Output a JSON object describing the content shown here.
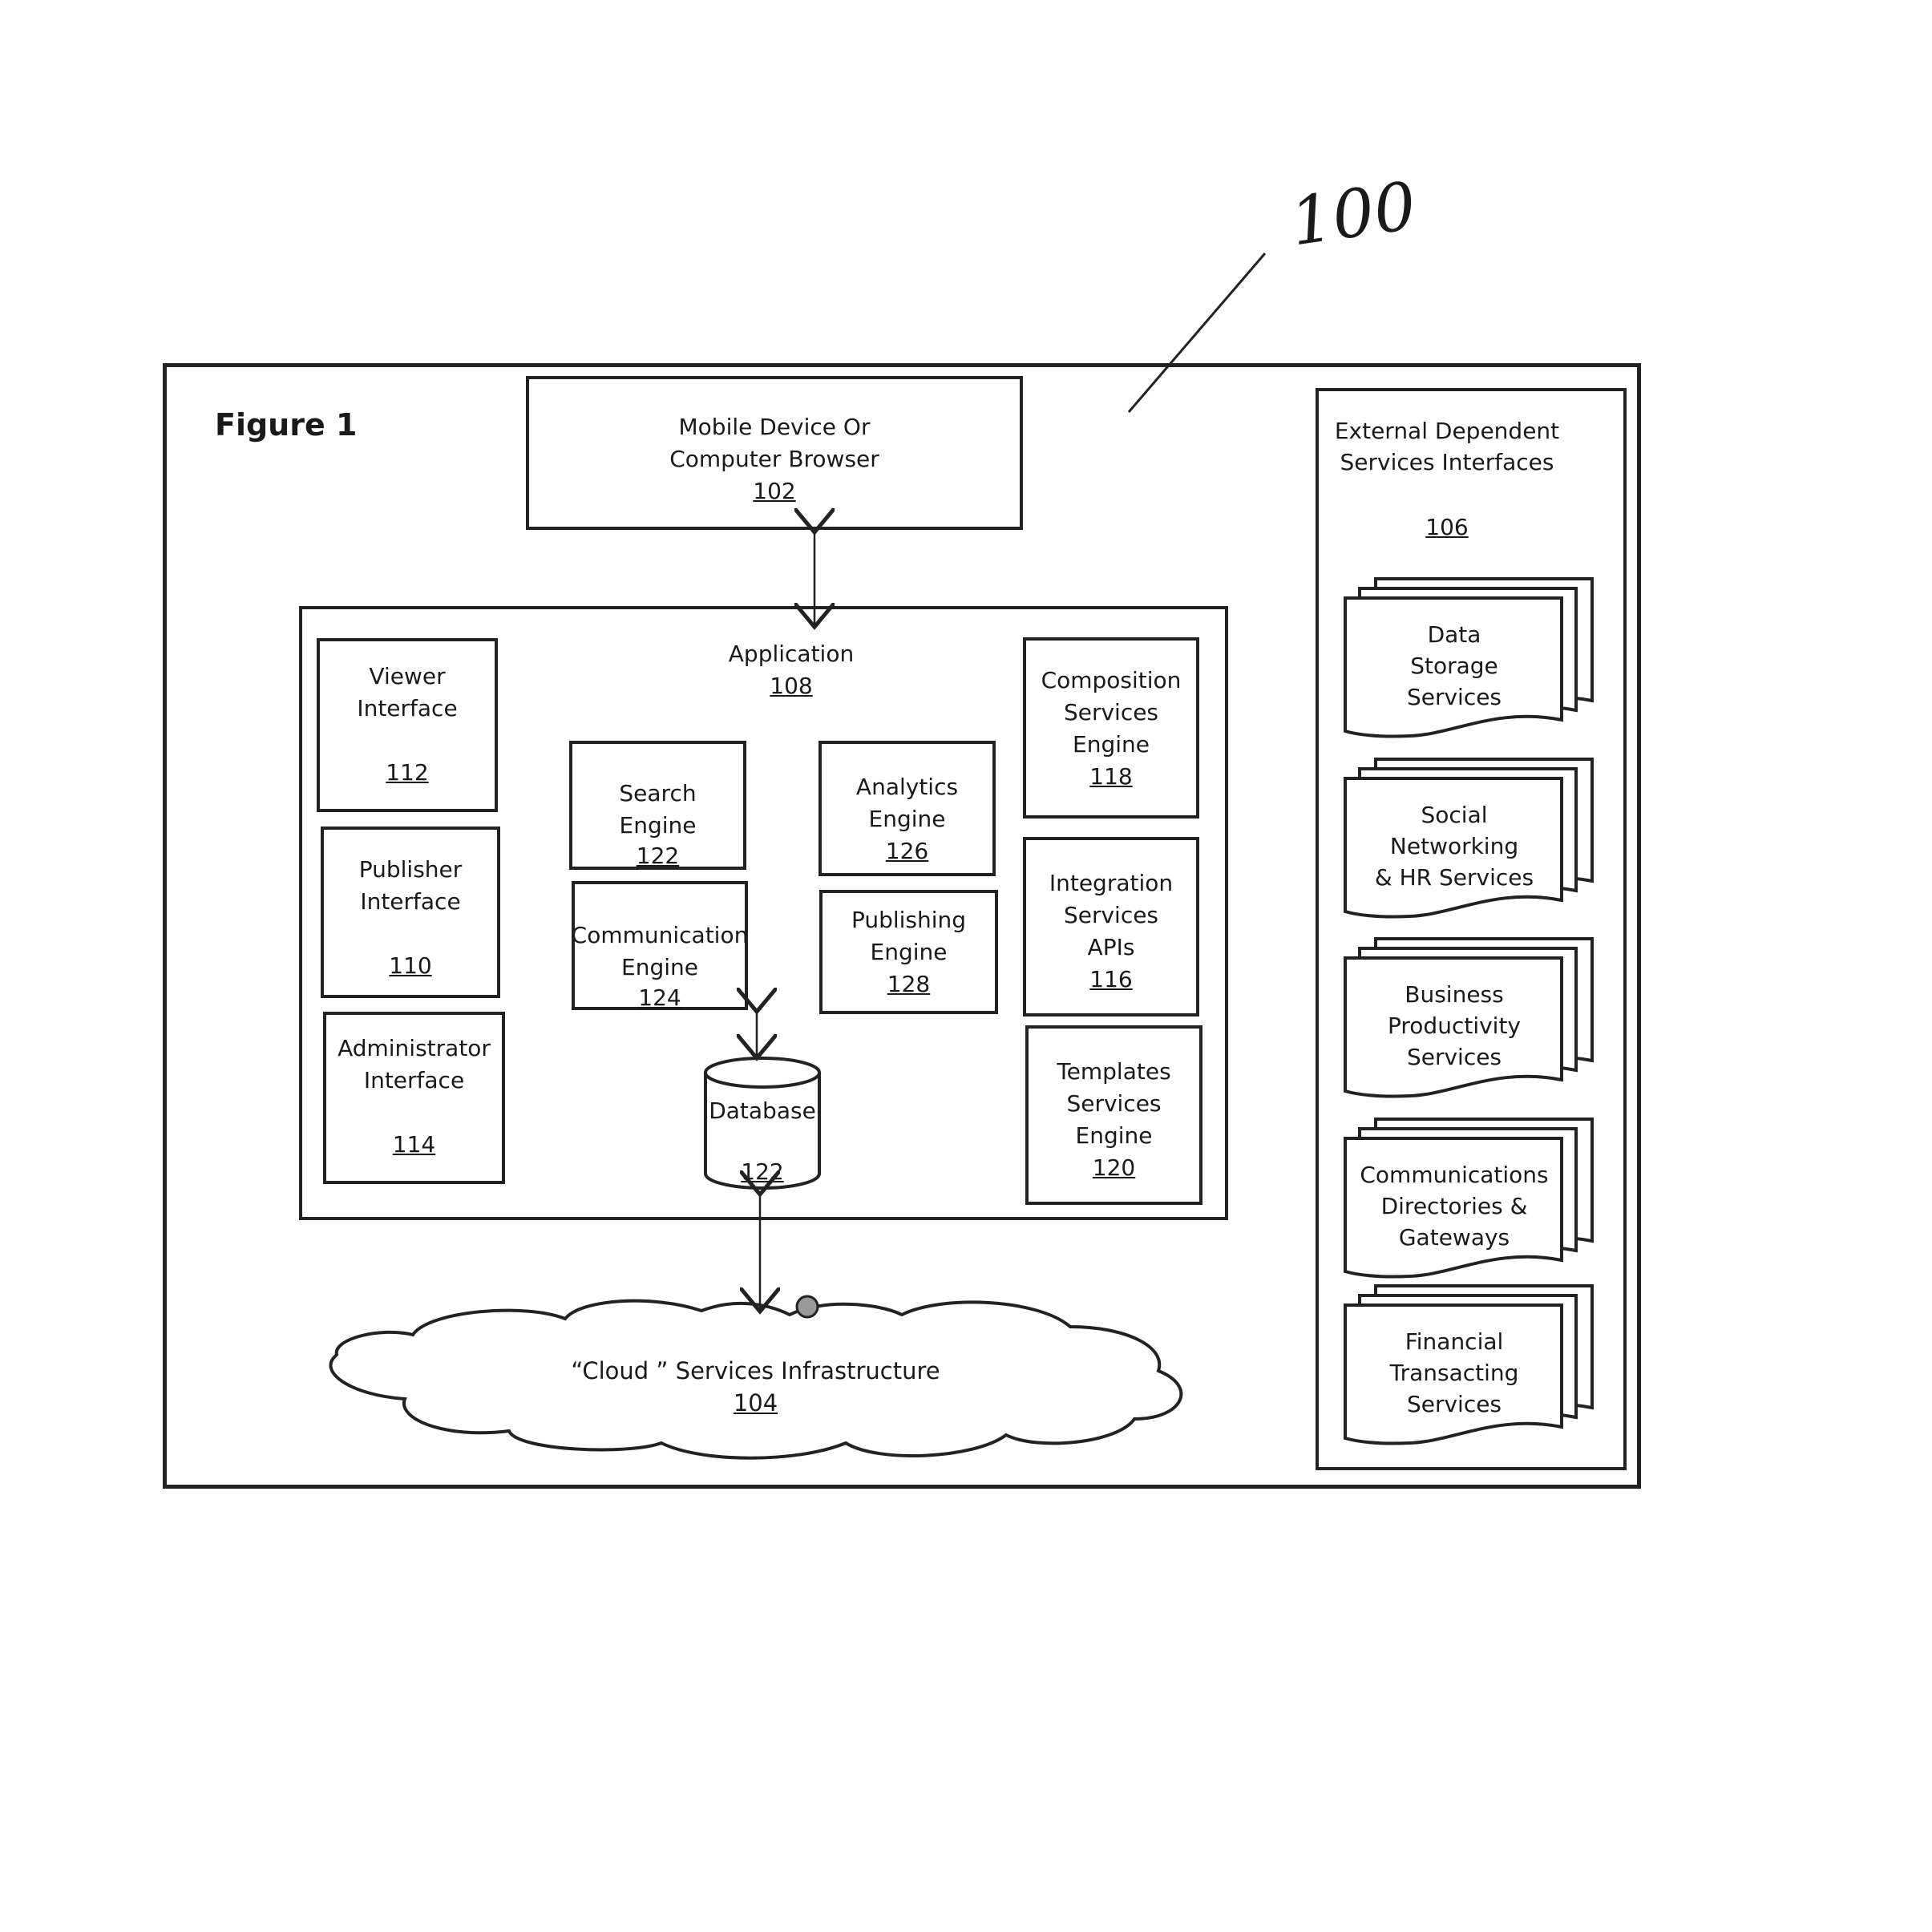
{
  "figure": {
    "label": "Figure 1",
    "system_ref": "100"
  },
  "client": {
    "lines": [
      "Mobile Device Or",
      "Computer Browser"
    ],
    "ref": "102"
  },
  "application": {
    "title": "Application",
    "ref": "108",
    "components": {
      "viewer": {
        "lines": [
          "Viewer",
          "Interface"
        ],
        "ref": "112"
      },
      "publisher": {
        "lines": [
          "Publisher",
          "Interface"
        ],
        "ref": "110"
      },
      "administrator": {
        "lines": [
          "Administrator",
          "Interface"
        ],
        "ref": "114"
      },
      "search": {
        "lines": [
          "Search",
          "Engine"
        ],
        "ref": "122"
      },
      "communication": {
        "lines": [
          "Communication",
          "Engine"
        ],
        "ref": "124"
      },
      "analytics": {
        "lines": [
          "Analytics",
          "Engine"
        ],
        "ref": "126"
      },
      "publishing": {
        "lines": [
          "Publishing",
          "Engine"
        ],
        "ref": "128"
      },
      "composition": {
        "lines": [
          "Composition",
          "Services",
          "Engine"
        ],
        "ref": "118"
      },
      "integration": {
        "lines": [
          "Integration",
          "Services",
          "APIs"
        ],
        "ref": "116"
      },
      "templates": {
        "lines": [
          "Templates",
          "Services",
          "Engine"
        ],
        "ref": "120"
      },
      "database": {
        "label": "Database",
        "ref": "122"
      }
    }
  },
  "cloud": {
    "label": "“Cloud ” Services Infrastructure",
    "ref": "104"
  },
  "external": {
    "lines": [
      "External Dependent",
      "Services Interfaces"
    ],
    "ref": "106",
    "services": [
      {
        "lines": [
          "Data",
          "Storage",
          "Services"
        ]
      },
      {
        "lines": [
          "Social",
          "Networking",
          "& HR Services"
        ]
      },
      {
        "lines": [
          "Business",
          "Productivity",
          "Services"
        ]
      },
      {
        "lines": [
          "Communications",
          "Directories &",
          "Gateways"
        ]
      },
      {
        "lines": [
          "Financial",
          "Transacting",
          "Services"
        ]
      }
    ]
  }
}
